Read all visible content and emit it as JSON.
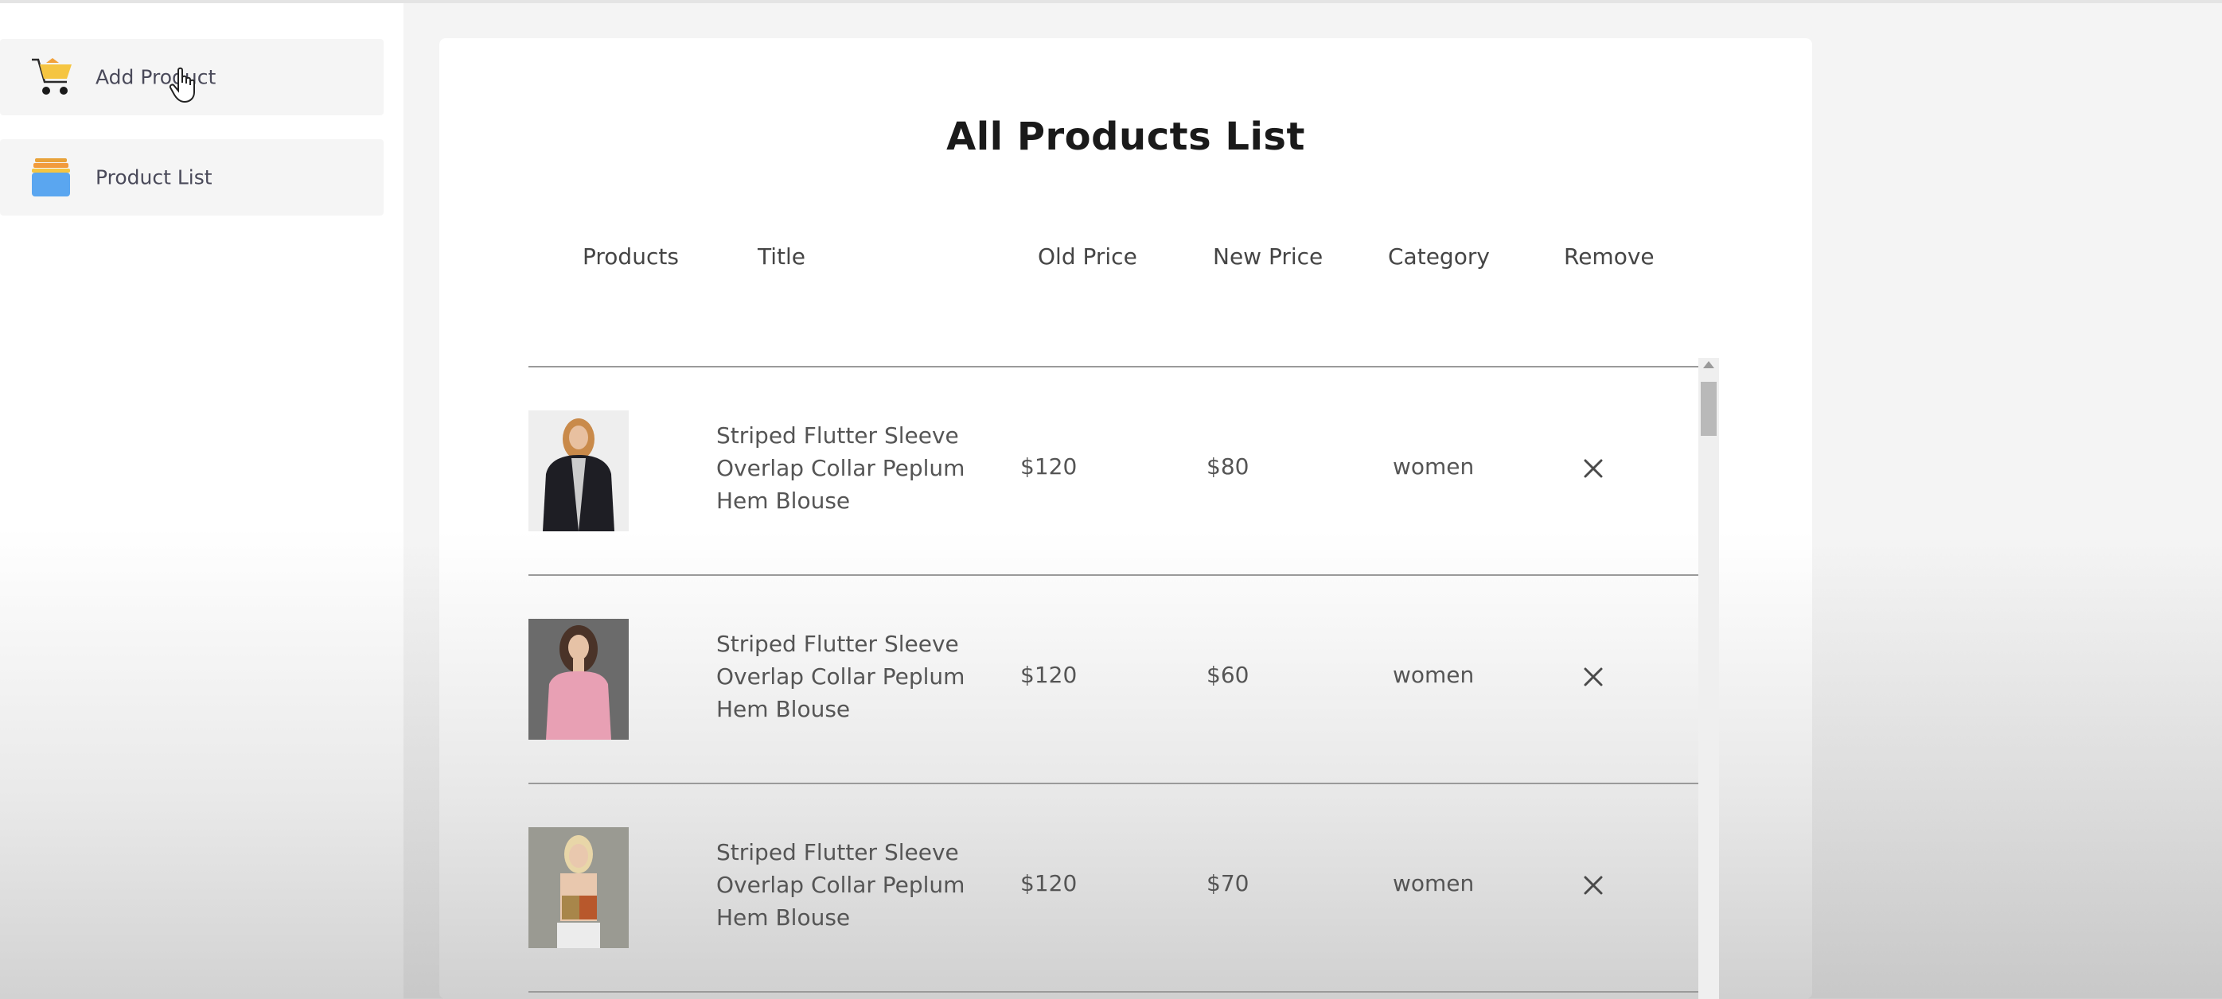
{
  "sidebar": {
    "items": [
      {
        "label": "Add Product",
        "icon": "cart-icon"
      },
      {
        "label": "Product List",
        "icon": "product-list-icon"
      }
    ]
  },
  "main": {
    "title": "All Products List",
    "columns": [
      "Products",
      "Title",
      "Old Price",
      "New Price",
      "Category",
      "Remove"
    ],
    "rows": [
      {
        "title": "Striped Flutter Sleeve Overlap Collar Peplum Hem Blouse",
        "old_price": "$120",
        "new_price": "$80",
        "category": "women",
        "image": "black-fur-jacket"
      },
      {
        "title": "Striped Flutter Sleeve Overlap Collar Peplum Hem Blouse",
        "old_price": "$120",
        "new_price": "$60",
        "category": "women",
        "image": "pink-top"
      },
      {
        "title": "Striped Flutter Sleeve Overlap Collar Peplum Hem Blouse",
        "old_price": "$120",
        "new_price": "$70",
        "category": "women",
        "image": "two-tone-crop-top"
      }
    ]
  },
  "colors": {
    "cart_yellow": "#f5c542",
    "list_blue": "#5aa6f0",
    "list_orange": "#f29b3c",
    "text_dark": "#1a1a1a",
    "text_body": "#555555"
  }
}
